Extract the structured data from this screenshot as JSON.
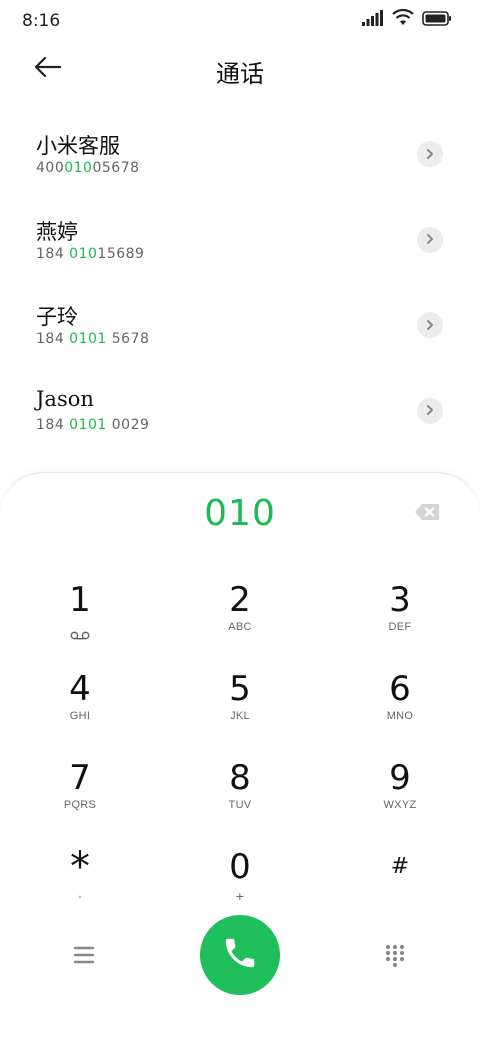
{
  "status_bar": {
    "time": "8:16",
    "icons": [
      "signal-icon",
      "wifi-icon",
      "battery-icon"
    ]
  },
  "header": {
    "title": "通话",
    "back_icon": "back-arrow-icon"
  },
  "contacts": [
    {
      "name": "小米客服",
      "number_pre": "400",
      "number_match": "010",
      "number_post": "05678"
    },
    {
      "name": "燕婷",
      "number_pre": "184 ",
      "number_match": "010",
      "number_post": "15689"
    },
    {
      "name": "子玲",
      "number_pre": "184 ",
      "number_match": "0101",
      "number_post": " 5678"
    },
    {
      "name": "Jason",
      "number_pre": "184 ",
      "number_match": "0101",
      "number_post": " 0029"
    }
  ],
  "dialer": {
    "input": "010",
    "keys": [
      {
        "digit": "1",
        "letters": ""
      },
      {
        "digit": "2",
        "letters": "ABC"
      },
      {
        "digit": "3",
        "letters": "DEF"
      },
      {
        "digit": "4",
        "letters": "GHI"
      },
      {
        "digit": "5",
        "letters": "JKL"
      },
      {
        "digit": "6",
        "letters": "MNO"
      },
      {
        "digit": "7",
        "letters": "PQRS"
      },
      {
        "digit": "8",
        "letters": "TUV"
      },
      {
        "digit": "9",
        "letters": "WXYZ"
      },
      {
        "digit": "*",
        "letters": ","
      },
      {
        "digit": "0",
        "letters": "+"
      },
      {
        "digit": "#",
        "letters": ""
      }
    ]
  },
  "colors": {
    "accent_green": "#1db954",
    "call_button": "#1fbf5b",
    "arrow_bg": "#ececec"
  }
}
